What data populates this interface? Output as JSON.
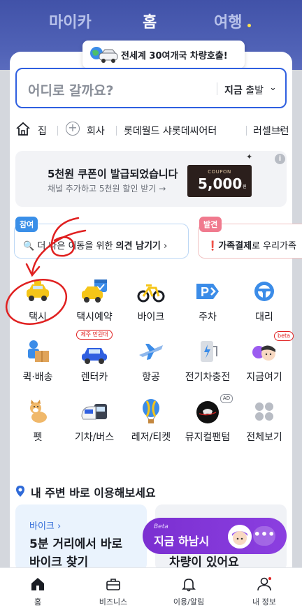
{
  "top_tabs": {
    "mycar": "마이카",
    "home": "홈",
    "travel": "여행"
  },
  "promo_chip": {
    "text": "전세계 30여개국 차량호출!"
  },
  "search": {
    "placeholder": "어디로 갈까요?",
    "now_bold": "지금",
    "now_rest": " 출발"
  },
  "shortcuts": [
    {
      "label": "집",
      "icon": "home-icon"
    },
    {
      "label": "회사",
      "icon": "plus-icon"
    },
    {
      "label": "롯데월드 샤롯데씨어터"
    },
    {
      "label": "러셀브런"
    }
  ],
  "coupon": {
    "title": "5천원 쿠폰이 발급되었습니다",
    "subtitle": "채널 추가하고 5천원 할인 받기 →",
    "ticket_label": "COUPON",
    "ticket_amount": "5,000",
    "ticket_unit": "원"
  },
  "banners": [
    {
      "badge": "참여",
      "text_pre": "더 나은 이동을 위한 ",
      "text_bold": "의견 남기기",
      "suffix": " ›"
    },
    {
      "badge": "발견",
      "text_bold": "가족결제",
      "text_post": "로 우리가족"
    }
  ],
  "services": [
    {
      "label": "택시",
      "icon": "taxi-icon"
    },
    {
      "label": "택시예약",
      "icon": "taxi-reservation-icon"
    },
    {
      "label": "바이크",
      "icon": "bike-icon"
    },
    {
      "label": "주차",
      "icon": "parking-icon"
    },
    {
      "label": "대리",
      "icon": "steering-wheel-icon"
    },
    {
      "label": "퀵·배송",
      "icon": "delivery-icon"
    },
    {
      "label": "렌터카",
      "icon": "rental-car-icon",
      "tag": "제주 만원대"
    },
    {
      "label": "항공",
      "icon": "airplane-icon"
    },
    {
      "label": "전기차충전",
      "icon": "ev-charger-icon"
    },
    {
      "label": "지금여기",
      "icon": "now-here-icon",
      "tag": "beta"
    },
    {
      "label": "펫",
      "icon": "pet-icon"
    },
    {
      "label": "기차/버스",
      "icon": "train-bus-icon"
    },
    {
      "label": "레저/티켓",
      "icon": "balloon-icon"
    },
    {
      "label": "뮤지컬팬텀",
      "icon": "musical-icon",
      "tag": "AD"
    },
    {
      "label": "전체보기",
      "icon": "view-all-icon"
    }
  ],
  "nearby": {
    "title": "내 주변 바로 이용해보세요",
    "card1": {
      "kind": "바이크 ›",
      "line1": "5분 거리에서 바로",
      "line2": "바이크 찾기"
    },
    "card2": {
      "line3": "차량이 있어요"
    }
  },
  "floater": {
    "beta": "Beta",
    "text": "지금 하남시",
    "more": "•••"
  },
  "bottom_nav": [
    {
      "label": "홈",
      "icon": "home-filled-icon"
    },
    {
      "label": "비즈니스",
      "icon": "briefcase-icon"
    },
    {
      "label": "이용/알림",
      "icon": "bell-icon"
    },
    {
      "label": "내 정보",
      "icon": "person-icon"
    }
  ],
  "colors": {
    "header": "#4152a8",
    "accent": "#2f5fe0",
    "purple": "#7b2fd1",
    "annotation": "#e02020"
  }
}
